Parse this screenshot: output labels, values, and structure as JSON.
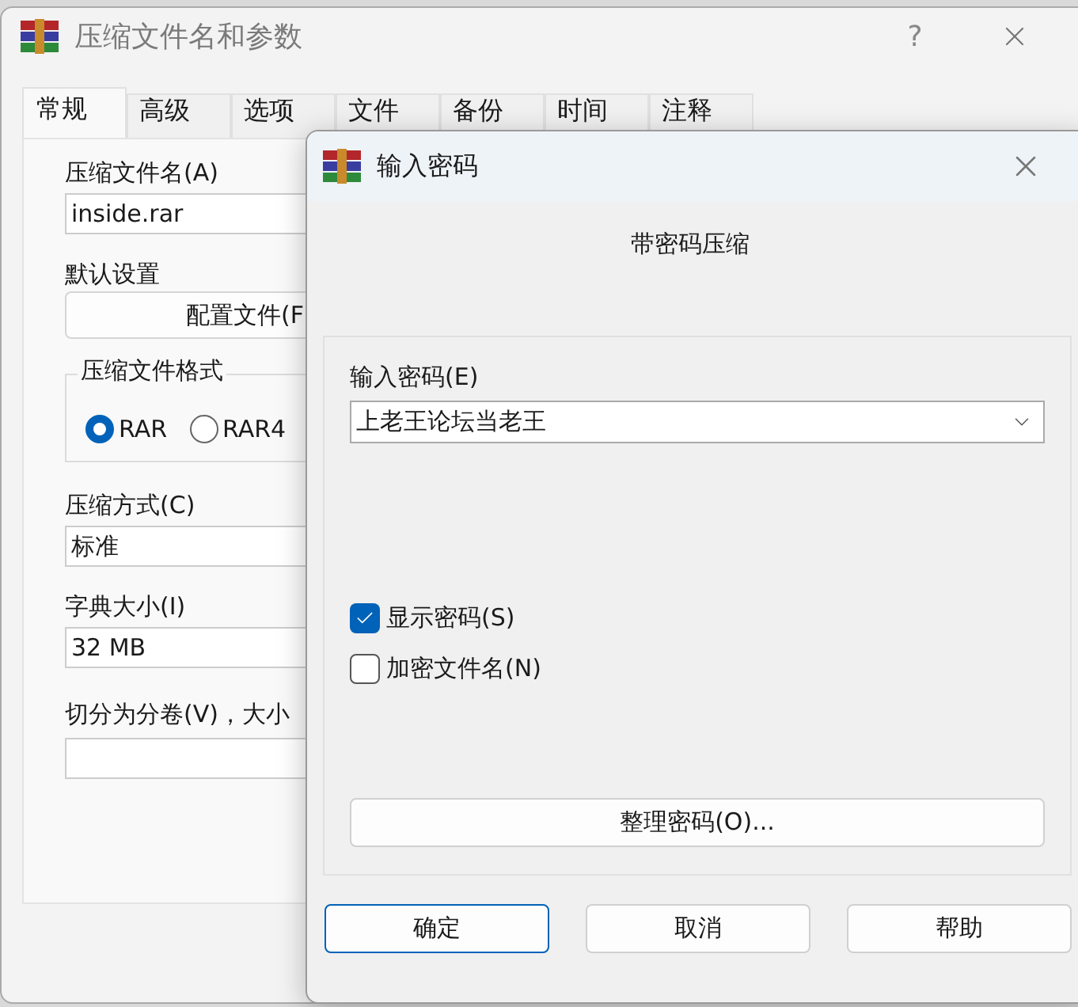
{
  "back_window": {
    "title": "压缩文件名和参数",
    "help": "?",
    "tabs": [
      {
        "label": "常规",
        "selected": true
      },
      {
        "label": "高级",
        "selected": false
      },
      {
        "label": "选项",
        "selected": false
      },
      {
        "label": "文件",
        "selected": false
      },
      {
        "label": "备份",
        "selected": false
      },
      {
        "label": "时间",
        "selected": false
      },
      {
        "label": "注释",
        "selected": false
      }
    ],
    "archive_name": {
      "label": "压缩文件名(A)",
      "value": "inside.rar"
    },
    "defaults": {
      "label": "默认设置",
      "button": "配置文件(F"
    },
    "format": {
      "legend": "压缩文件格式",
      "options": [
        {
          "label": "RAR",
          "selected": true
        },
        {
          "label": "RAR4",
          "selected": false
        }
      ]
    },
    "method": {
      "label": "压缩方式(C)",
      "value": "标准"
    },
    "dictionary": {
      "label": "字典大小(I)",
      "value": "32 MB"
    },
    "split": {
      "label": "切分为分卷(V)，大小"
    }
  },
  "dialog": {
    "title": "输入密码",
    "subtitle": "带密码压缩",
    "password": {
      "label": "输入密码(E)",
      "value": "上老王论坛当老王"
    },
    "options": [
      {
        "label": "显示密码(S)",
        "checked": true
      },
      {
        "label": "加密文件名(N)",
        "checked": false
      }
    ],
    "organize_button": "整理密码(O)...",
    "buttons": [
      {
        "label": "确定",
        "selected": true
      },
      {
        "label": "取消",
        "selected": false
      },
      {
        "label": "帮助",
        "selected": false
      }
    ]
  }
}
